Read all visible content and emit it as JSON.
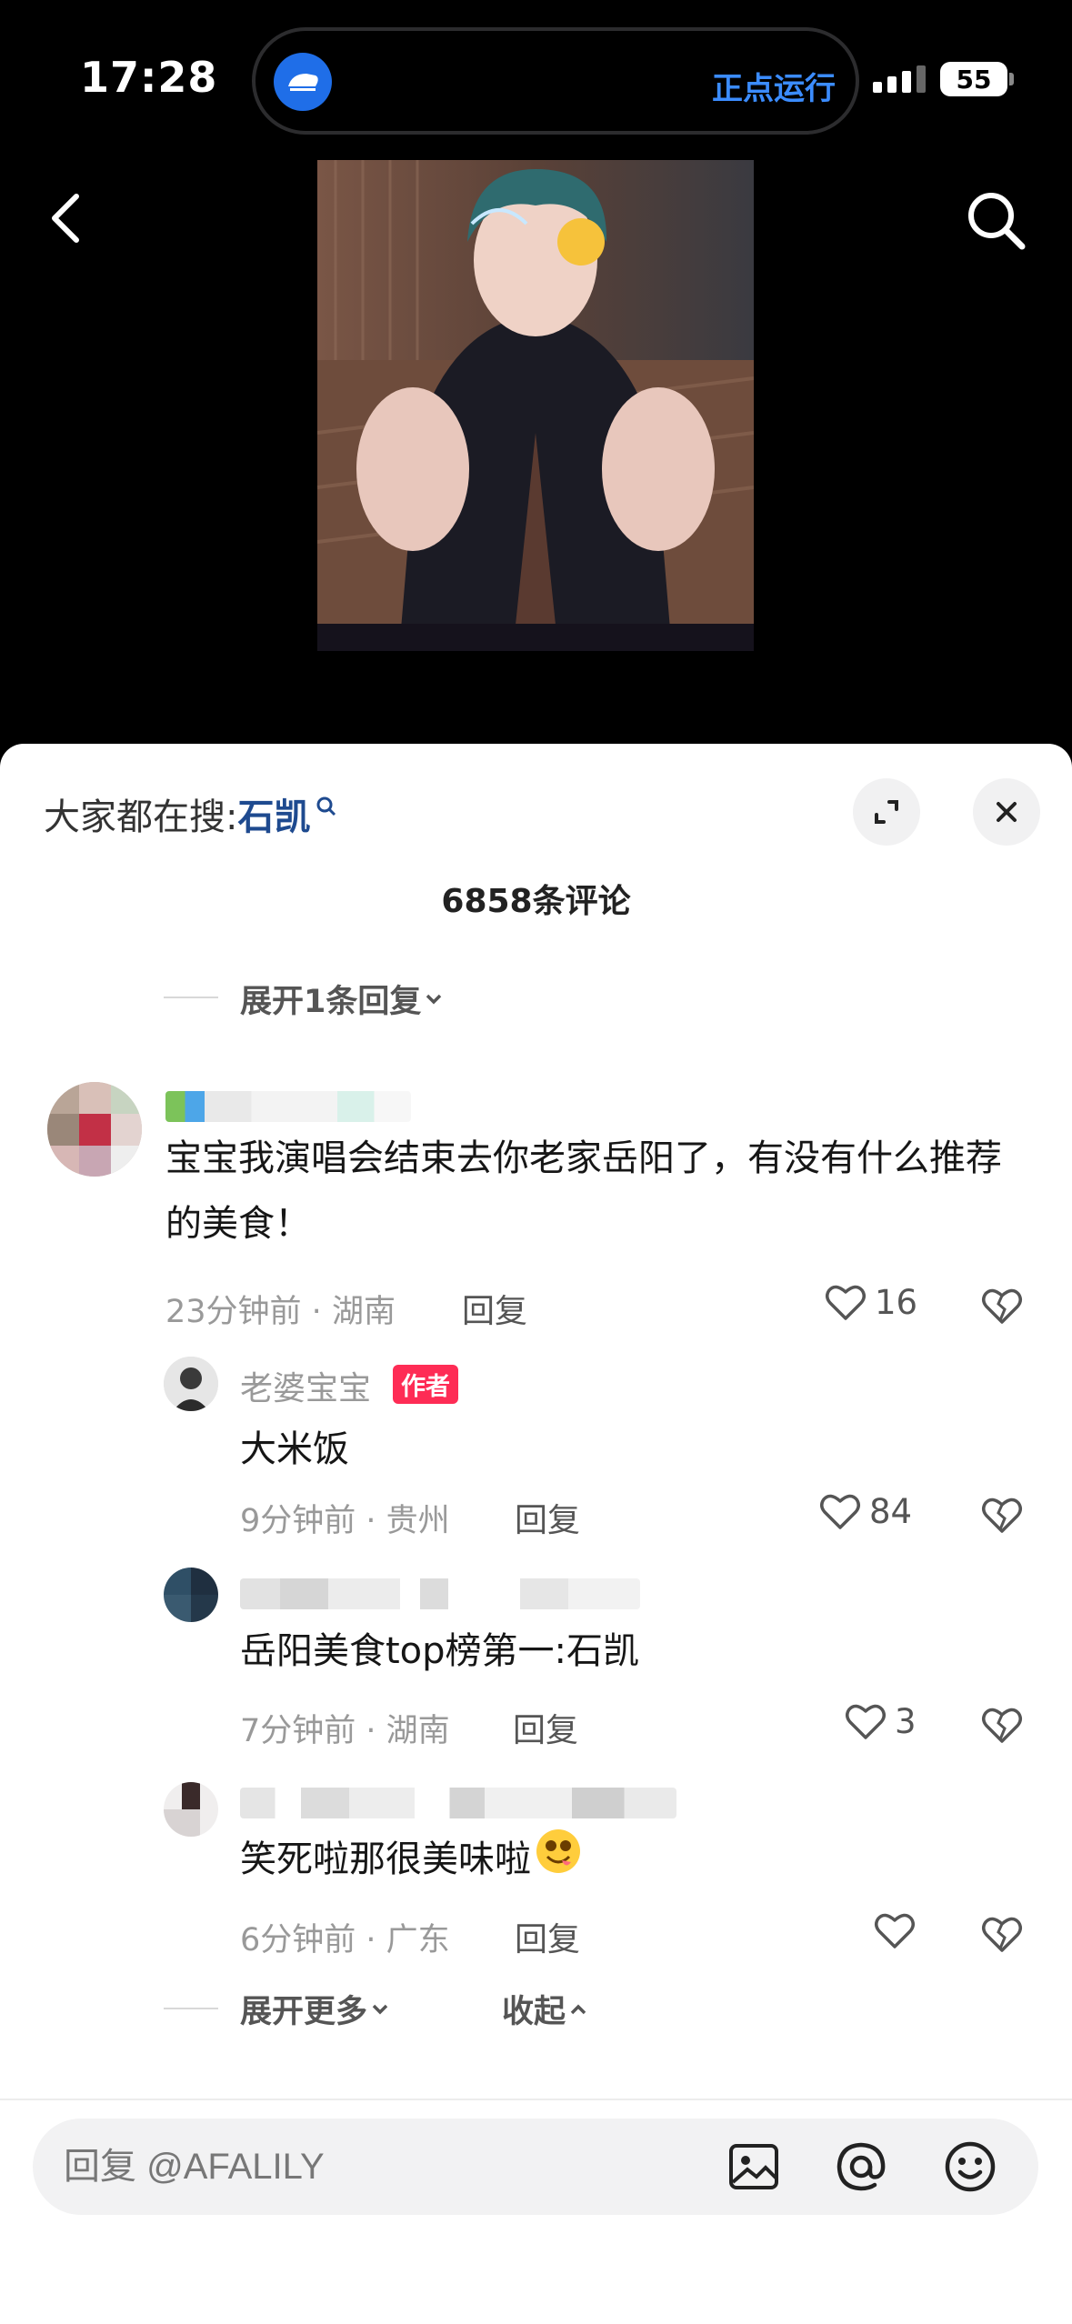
{
  "status_bar": {
    "time": "17:28",
    "island_text": "正点运行",
    "battery": "55"
  },
  "panel": {
    "search_prefix": "大家都在搜:",
    "search_keyword": "石凯",
    "comment_count": "6858条评论",
    "expand_one_reply": "展开1条回复",
    "expand_more": "展开更多",
    "collapse": "收起"
  },
  "comments": [
    {
      "text": "宝宝我演唱会结束去你老家岳阳了，有没有什么推荐的美食！",
      "time": "23分钟前",
      "location": "湖南",
      "reply_label": "回复",
      "likes": "16"
    }
  ],
  "replies": [
    {
      "username": "老婆宝宝",
      "badge": "作者",
      "text": "大米饭",
      "time": "9分钟前",
      "location": "贵州",
      "reply_label": "回复",
      "likes": "84"
    },
    {
      "text": "岳阳美食top榜第一:石凯",
      "time": "7分钟前",
      "location": "湖南",
      "reply_label": "回复",
      "likes": "3"
    },
    {
      "text": "笑死啦那很美味啦",
      "time": "6分钟前",
      "location": "广东",
      "reply_label": "回复",
      "likes": ""
    }
  ],
  "input": {
    "placeholder": "回复 @AFALILY"
  },
  "colors": {
    "accent_blue": "#1e4a8f",
    "badge_red": "#fe2c55",
    "island_text": "#3b8cff"
  },
  "icons": [
    "back-arrow-icon",
    "search-icon",
    "expand-icon",
    "close-icon",
    "heart-icon",
    "broken-heart-icon",
    "image-icon",
    "at-icon",
    "emoji-icon"
  ]
}
